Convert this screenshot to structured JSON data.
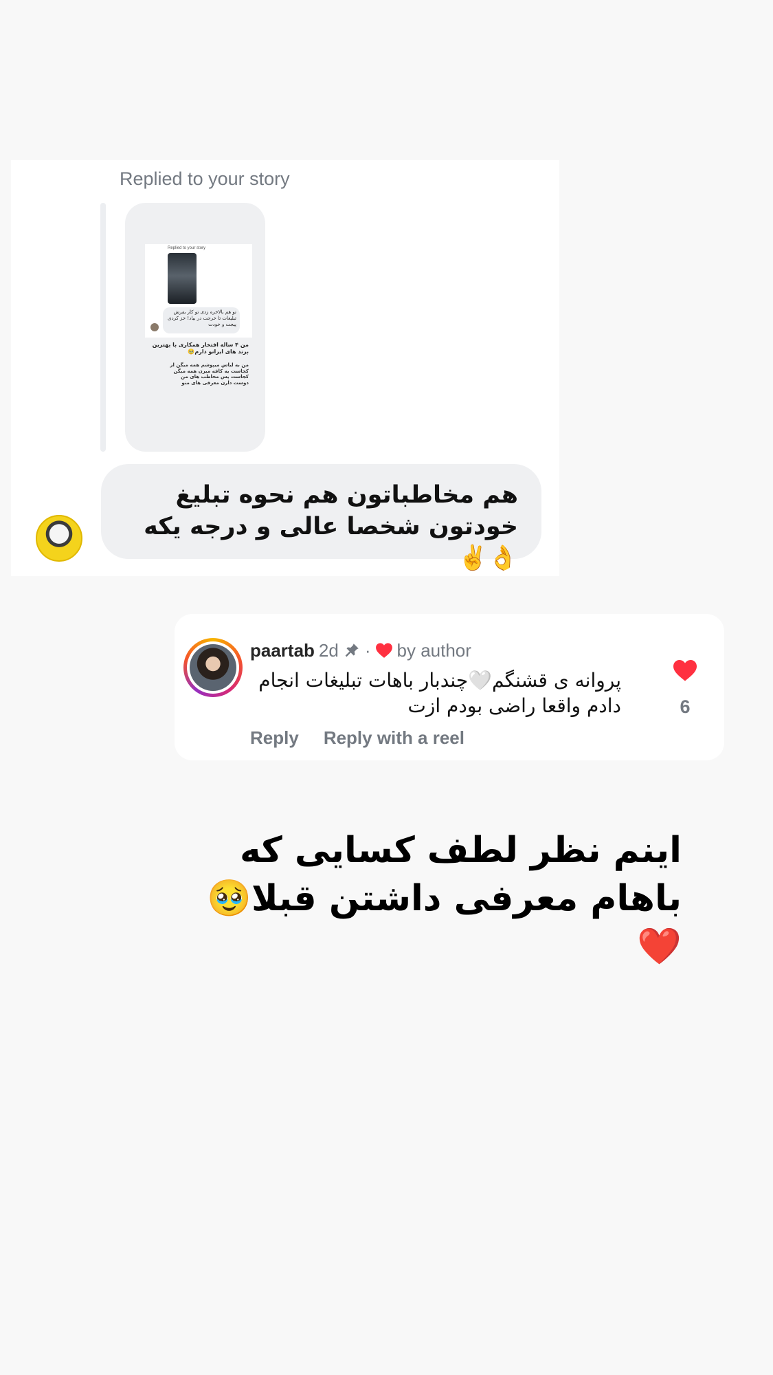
{
  "dm": {
    "replied_label": "Replied to your story",
    "story_preview": {
      "replied_label": "Replied to your story",
      "bubble_text": "تو هم بالاخره زدی تو کار بفرش تبلیغات تا خرجت در بیاد! خز کردی پیجت و خودت",
      "text_1": "من ۴ ساله افتخار همکاری با بهترین برند های ایرانو دارم🥹",
      "text_2": "من به لباس میپوشم همه میگن از کجاست یه کافه میرن همه میگن کجاست پس مخاطب های من دوست دارن معرفی های منو"
    },
    "message": "هم مخاطباتون هم نحوه تبلیغ خودتون شخصا عالی و درجه یکه 👌✌️"
  },
  "comment": {
    "username": "paartab",
    "age": "2d",
    "separator": "·",
    "liked_by": "by author",
    "text": "پروانه ی قشنگم🤍چندبار باهات تبلیغات انجام دادم واقعا راضی بودم ازت",
    "reply_label": "Reply",
    "reply_reel_label": "Reply with a reel",
    "like_count": "6"
  },
  "caption": "اینم نظر لطف کسایی که باهام معرفی داشتن قبلا🥹❤️",
  "colors": {
    "background": "#f8f8f8",
    "heart": "#ff3040",
    "muted_text": "#737981"
  },
  "icons": [
    "pin-icon",
    "heart-icon",
    "like-heart-icon"
  ]
}
